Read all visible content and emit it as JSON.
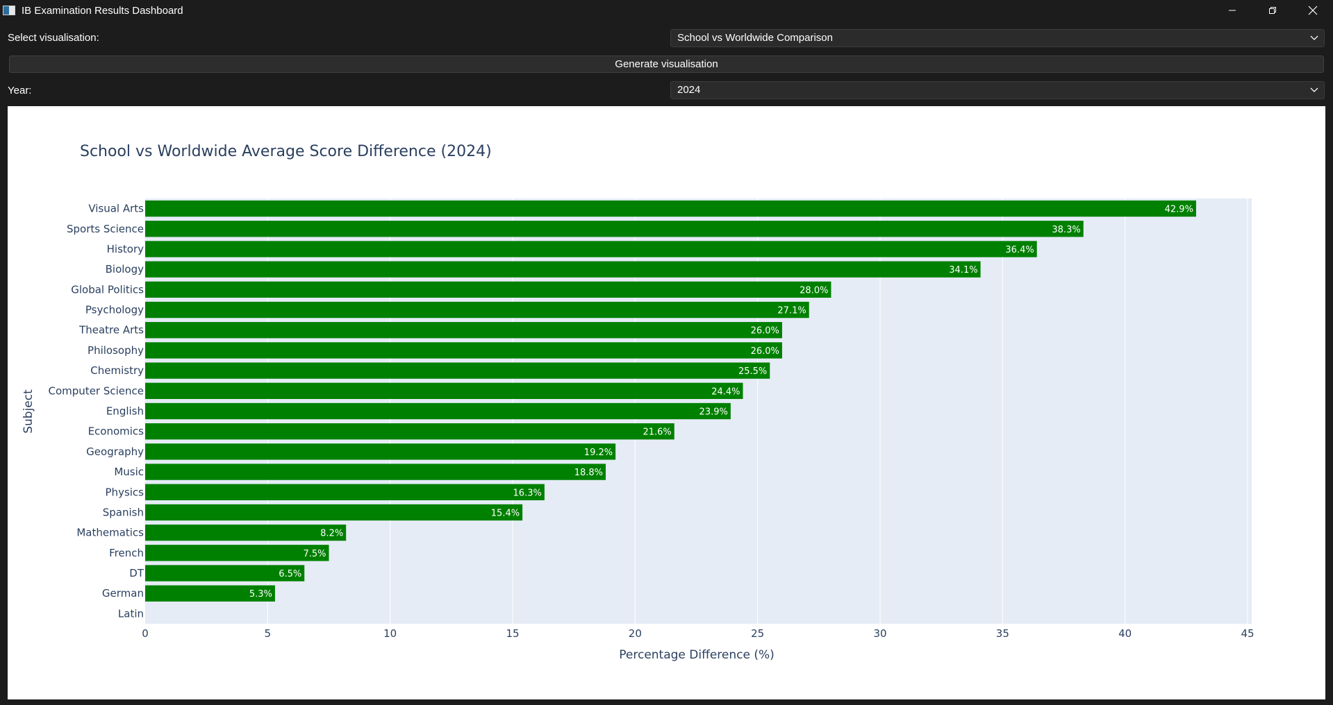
{
  "window": {
    "title": "IB Examination Results Dashboard",
    "icon": "app-window-icon",
    "controls": [
      "minimize",
      "restore",
      "close"
    ]
  },
  "controls": {
    "visualisation_label": "Select visualisation:",
    "visualisation_value": "School vs Worldwide Comparison",
    "generate_button": "Generate visualisation",
    "year_label": "Year:",
    "year_value": "2024"
  },
  "colors": {
    "bar": "#008000",
    "plot_bg": "#e5ecf6",
    "text": "#2a3f5f",
    "window_bg": "#1c1c1c"
  },
  "chart_data": {
    "type": "bar",
    "orientation": "horizontal",
    "title": "School vs Worldwide Average Score Difference (2024)",
    "xlabel": "Percentage Difference (%)",
    "ylabel": "Subject",
    "xlim": [
      0,
      45
    ],
    "xticks": [
      0,
      5,
      10,
      15,
      20,
      25,
      30,
      35,
      40,
      45
    ],
    "grid": true,
    "categories": [
      "Visual Arts",
      "Sports Science",
      "History",
      "Biology",
      "Global Politics",
      "Psychology",
      "Theatre Arts",
      "Philosophy",
      "Chemistry",
      "Computer Science",
      "English",
      "Economics",
      "Geography",
      "Music",
      "Physics",
      "Spanish",
      "Mathematics",
      "French",
      "DT",
      "German",
      "Latin"
    ],
    "values": [
      42.9,
      38.3,
      36.4,
      34.1,
      28.0,
      27.1,
      26.0,
      26.0,
      25.5,
      24.4,
      23.9,
      21.6,
      19.2,
      18.8,
      16.3,
      15.4,
      8.2,
      7.5,
      6.5,
      5.3,
      0
    ],
    "data_labels": [
      "42.9%",
      "38.3%",
      "36.4%",
      "34.1%",
      "28.0%",
      "27.1%",
      "26.0%",
      "26.0%",
      "25.5%",
      "24.4%",
      "23.9%",
      "21.6%",
      "19.2%",
      "18.8%",
      "16.3%",
      "15.4%",
      "8.2%",
      "7.5%",
      "6.5%",
      "5.3%",
      ""
    ]
  }
}
